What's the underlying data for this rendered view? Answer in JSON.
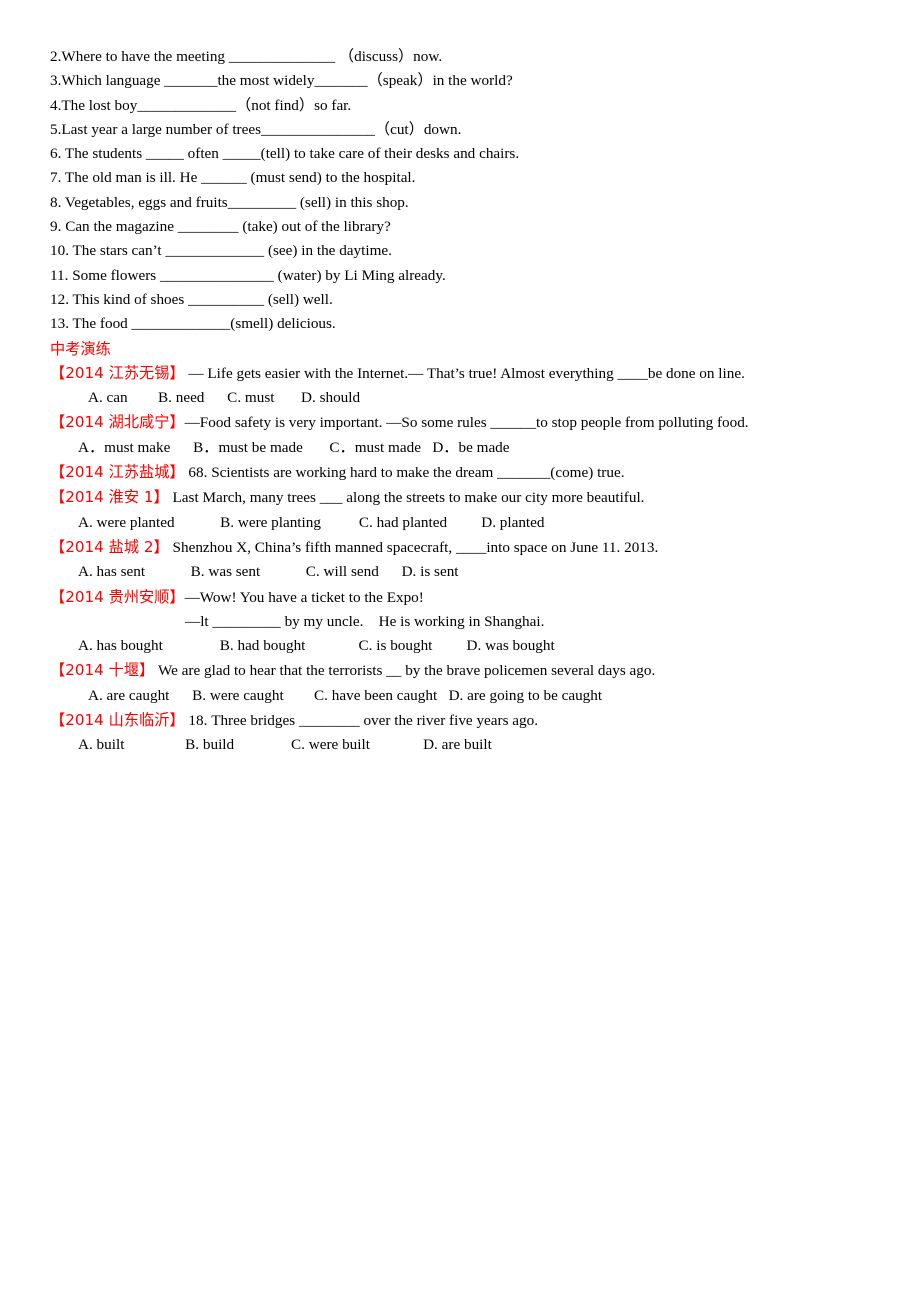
{
  "document": {
    "page_background": "#ffffff",
    "text_color": "#000000",
    "accent_color": "#ff0000"
  },
  "fill_in_questions": [
    {
      "id": "q2",
      "text": "2.Where to have the meeting ______________ （discuss）now."
    },
    {
      "id": "q3",
      "text": "3.Which language _______the most widely_______（speak）in the world?"
    },
    {
      "id": "q4",
      "text": "4.The lost boy_____________（not find）so far."
    },
    {
      "id": "q5",
      "text": "5.Last year a large number of trees_______________（cut）down."
    },
    {
      "id": "q6",
      "text": "6. The students _____ often _____(tell) to take care of their desks and chairs."
    },
    {
      "id": "q7",
      "text": "7. The old man is ill. He ______ (must send) to the hospital."
    },
    {
      "id": "q8",
      "text": "8. Vegetables, eggs and fruits_________ (sell) in this shop."
    },
    {
      "id": "q9",
      "text": "9. Can the magazine ________ (take) out of the library?"
    },
    {
      "id": "q10",
      "text": "10. The stars can’t _____________ (see) in the daytime."
    },
    {
      "id": "q11",
      "text": "11. Some flowers _______________ (water) by Li Ming already."
    },
    {
      "id": "q12",
      "text": "12. This kind of shoes __________ (sell) well."
    },
    {
      "id": "q13",
      "text": "13. The food _____________(smell) delicious."
    }
  ],
  "exam_section": {
    "heading": "中考演练",
    "items": [
      {
        "id": "e1",
        "tag": "【2014 江苏无锡】",
        "stem": " — Life gets easier with the Internet.— That’s true! Almost everything ____be done on line.",
        "options": "A. can        B. need      C. must       D. should",
        "options_indent": "ind2"
      },
      {
        "id": "e2",
        "tag": "【2014 湖北咸宁】",
        "stem": "—Food safety is very important. —So some rules ______to stop people from polluting food.",
        "options": "A．must make      B．must be made       C．must made   D．be made",
        "options_indent": "ind1"
      },
      {
        "id": "e3",
        "tag": "【2014 江苏盐城】",
        "stem": " 68. Scientists are working hard to make the dream _______(come) true.",
        "options": "",
        "options_indent": "ind1"
      },
      {
        "id": "e4",
        "tag": "【2014 淮安 1】",
        "stem": " Last March, many trees ___ along the streets to make our city more beautiful.",
        "options": "A. were planted            B. were planting          C. had planted         D. planted",
        "options_indent": "ind1"
      },
      {
        "id": "e5",
        "tag": "【2014 盐城 2】",
        "stem": " Shenzhou X, China’s fifth manned spacecraft, ____into space on June 11. 2013.",
        "options": "A. has sent            B. was sent            C. will send      D. is sent",
        "options_indent": "ind1"
      },
      {
        "id": "e6",
        "tag": "【2014 贵州安顺】",
        "stem": "—Wow! You have a ticket to the Expo!",
        "stem_line2": "—lt _________ by my uncle.    He is working in Shanghai.",
        "options": "A. has bought               B. had bought              C. is bought         D. was bought",
        "options_indent": "ind1"
      },
      {
        "id": "e7",
        "tag": "【2014 十堰】",
        "stem": " We are glad to hear that the terrorists __ by the brave policemen several days ago.",
        "options": "A. are caught      B. were caught        C. have been caught   D. are going to be caught",
        "options_indent": "ind2"
      },
      {
        "id": "e8",
        "tag": "【2014 山东临沂】",
        "stem": " 18. Three bridges ________ over the river five years ago.",
        "options": "A. built                B. build               C. were built              D. are built",
        "options_indent": "ind1"
      }
    ]
  }
}
